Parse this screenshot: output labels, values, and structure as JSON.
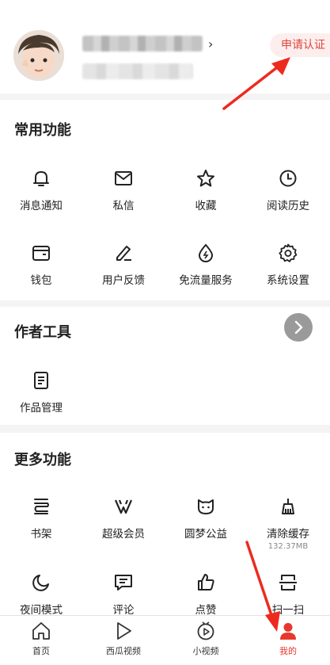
{
  "header": {
    "verify_label": "申请认证"
  },
  "common": {
    "title": "常用功能",
    "items": [
      {
        "label": "消息通知",
        "icon": "bell-icon"
      },
      {
        "label": "私信",
        "icon": "mail-icon"
      },
      {
        "label": "收藏",
        "icon": "star-icon"
      },
      {
        "label": "阅读历史",
        "icon": "clock-icon"
      },
      {
        "label": "钱包",
        "icon": "wallet-icon"
      },
      {
        "label": "用户反馈",
        "icon": "pen-icon"
      },
      {
        "label": "免流量服务",
        "icon": "drop-icon"
      },
      {
        "label": "系统设置",
        "icon": "gear-icon"
      }
    ]
  },
  "author": {
    "title": "作者工具",
    "items": [
      {
        "label": "作品管理",
        "icon": "document-icon"
      }
    ]
  },
  "more": {
    "title": "更多功能",
    "items": [
      {
        "label": "书架",
        "icon": "bookshelf-icon"
      },
      {
        "label": "超级会员",
        "icon": "vip-icon"
      },
      {
        "label": "圆梦公益",
        "icon": "charity-icon"
      },
      {
        "label": "清除缓存",
        "icon": "broom-icon",
        "sub": "132.37MB"
      },
      {
        "label": "夜间模式",
        "icon": "moon-icon"
      },
      {
        "label": "评论",
        "icon": "comment-icon"
      },
      {
        "label": "点赞",
        "icon": "thumbs-up-icon"
      },
      {
        "label": "扫一扫",
        "icon": "scan-icon"
      }
    ]
  },
  "tabbar": {
    "items": [
      {
        "label": "首页",
        "icon": "home-icon"
      },
      {
        "label": "西瓜视频",
        "icon": "play-icon"
      },
      {
        "label": "小视频",
        "icon": "small-video-icon"
      },
      {
        "label": "我的",
        "icon": "user-icon",
        "active": true
      }
    ]
  },
  "colors": {
    "accent": "#e8372c",
    "annotation": "#ee2a1e"
  }
}
